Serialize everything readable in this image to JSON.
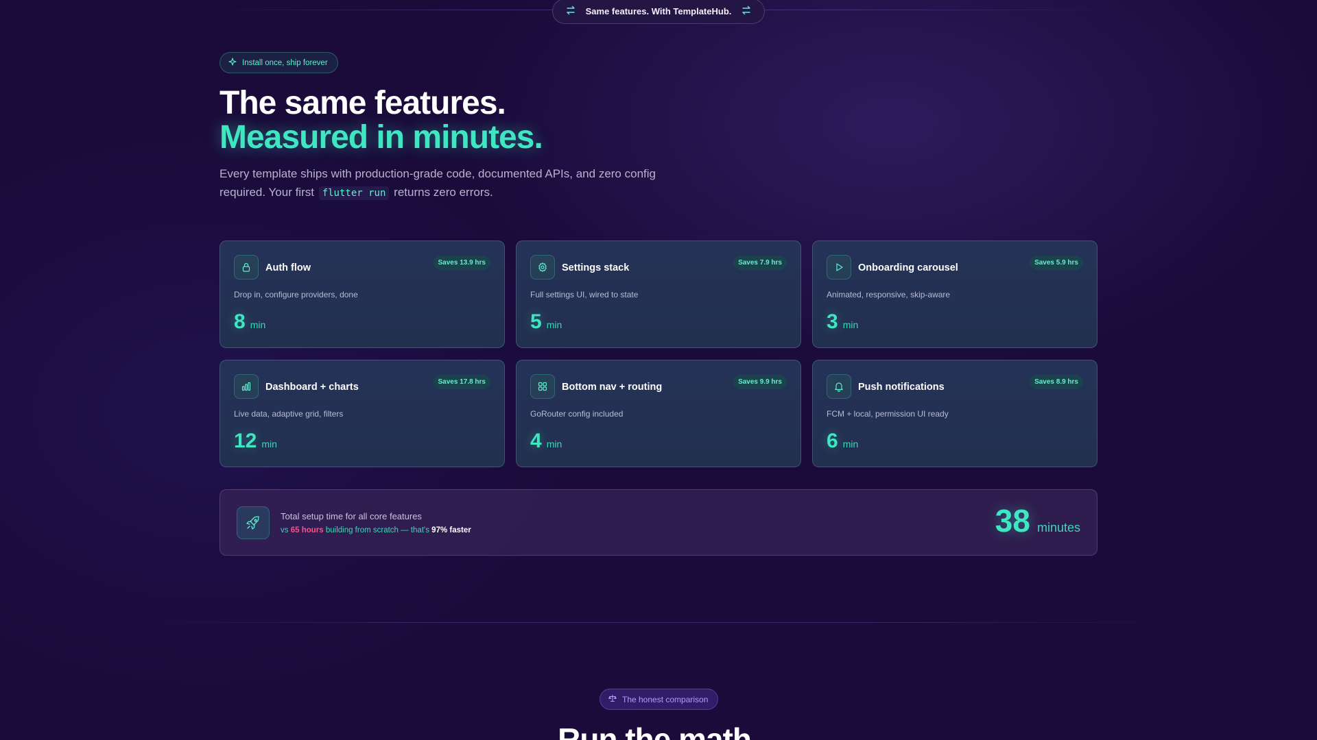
{
  "banner": {
    "text": "Same features. With TemplateHub.",
    "left_icon": "swap-icon",
    "right_icon": "swap-icon"
  },
  "hero": {
    "badge": "Install once, ship forever",
    "badge_icon": "sparkle-icon",
    "headline_line1": "The same features.",
    "headline_line2": "Measured in minutes.",
    "lede_before": "Every template ships with production-grade code, documented APIs, and zero config required. Your first",
    "lede_code": "flutter run",
    "lede_after": "returns zero errors."
  },
  "features": [
    {
      "icon": "lock-icon",
      "title": "Auth flow",
      "saves": "Saves 13.9 hrs",
      "desc": "Drop in, configure providers, done",
      "minutes": "8",
      "unit": "min"
    },
    {
      "icon": "gear-icon",
      "title": "Settings stack",
      "saves": "Saves 7.9 hrs",
      "desc": "Full settings UI, wired to state",
      "minutes": "5",
      "unit": "min"
    },
    {
      "icon": "play-icon",
      "title": "Onboarding carousel",
      "saves": "Saves 5.9 hrs",
      "desc": "Animated, responsive, skip-aware",
      "minutes": "3",
      "unit": "min"
    },
    {
      "icon": "bar-chart-icon",
      "title": "Dashboard + charts",
      "saves": "Saves 17.8 hrs",
      "desc": "Live data, adaptive grid, filters",
      "minutes": "12",
      "unit": "min"
    },
    {
      "icon": "grid-icon",
      "title": "Bottom nav + routing",
      "saves": "Saves 9.9 hrs",
      "desc": "GoRouter config included",
      "minutes": "4",
      "unit": "min"
    },
    {
      "icon": "bell-icon",
      "title": "Push notifications",
      "saves": "Saves 8.9 hrs",
      "desc": "FCM + local, permission UI ready",
      "minutes": "6",
      "unit": "min"
    }
  ],
  "total": {
    "icon": "rocket-icon",
    "label": "Total setup time for all core features",
    "sub_prefix": "vs",
    "sub_hours": "65 hours",
    "sub_middle": "building from scratch — that's",
    "sub_faster": "97% faster",
    "value": "38",
    "unit": "minutes"
  },
  "comparison": {
    "badge": "The honest comparison",
    "badge_icon": "scale-icon",
    "title": "Run the math."
  },
  "colors": {
    "background": "#1a0b3a",
    "accent": "#3fe6c2",
    "danger": "#ff4f86",
    "purple": "#b39bff"
  }
}
